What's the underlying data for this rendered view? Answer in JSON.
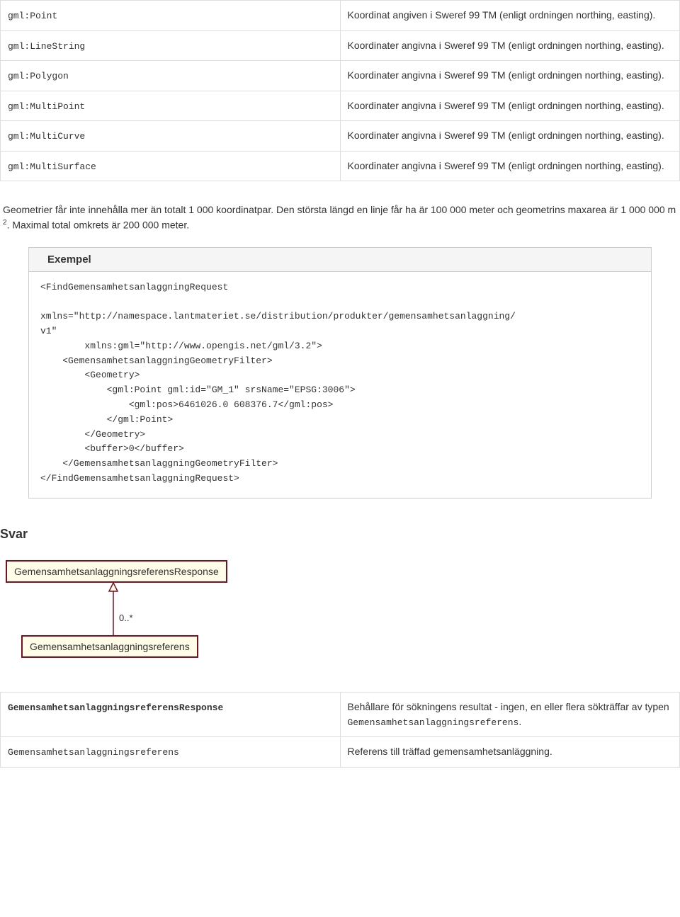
{
  "table1": {
    "rows": [
      {
        "key": "gml:Point",
        "desc": "Koordinat angiven i Sweref 99 TM (enligt ordningen northing, easting)."
      },
      {
        "key": "gml:LineString",
        "desc": "Koordinater angivna i Sweref 99 TM (enligt ordningen northing, easting)."
      },
      {
        "key": "gml:Polygon",
        "desc": "Koordinater angivna i Sweref 99 TM (enligt ordningen northing, easting)."
      },
      {
        "key": "gml:MultiPoint",
        "desc": "Koordinater angivna i Sweref 99 TM (enligt ordningen northing, easting)."
      },
      {
        "key": "gml:MultiCurve",
        "desc": "Koordinater angivna i Sweref 99 TM (enligt ordningen northing, easting)."
      },
      {
        "key": "gml:MultiSurface",
        "desc": "Koordinater angivna i Sweref 99 TM (enligt ordningen northing, easting)."
      }
    ]
  },
  "para": {
    "part1": "Geometrier får inte innehålla mer än totalt 1 000 koordinatpar. Den största längd en linje får ha är 100 000 meter och geometrins maxarea är 1 000 000 m ",
    "sup": "2",
    "part2": ". Maximal total omkrets är 200 000 meter."
  },
  "example": {
    "title": "Exempel",
    "code": "<FindGemensamhetsanlaggningRequest\n\nxmlns=\"http://namespace.lantmateriet.se/distribution/produkter/gemensamhetsanlaggning/\nv1\"\n        xmlns:gml=\"http://www.opengis.net/gml/3.2\">\n    <GemensamhetsanlaggningGeometryFilter>\n        <Geometry>\n            <gml:Point gml:id=\"GM_1\" srsName=\"EPSG:3006\">\n                <gml:pos>6461026.0 608376.7</gml:pos>\n            </gml:Point>\n        </Geometry>\n        <buffer>0</buffer>\n    </GemensamhetsanlaggningGeometryFilter>\n</FindGemensamhetsanlaggningRequest>"
  },
  "svar": {
    "heading": "Svar",
    "diagram": {
      "top": "GemensamhetsanlaggningsreferensResponse",
      "bottom": "Gemensamhetsanlaggningsreferens",
      "mult": "0..*"
    }
  },
  "table2": {
    "rows": [
      {
        "key": "GemensamhetsanlaggningsreferensResponse",
        "keyBold": true,
        "descPrefix": "Behållare för sökningens resultat - ingen, en eller flera sökträffar av typen ",
        "descCode": "Gemensamhetsanlaggningsreferens",
        "descSuffix": "."
      },
      {
        "key": "Gemensamhetsanlaggningsreferens",
        "keyBold": false,
        "descPrefix": "Referens till träffad gemensamhetsanläggning.",
        "descCode": "",
        "descSuffix": ""
      }
    ]
  }
}
